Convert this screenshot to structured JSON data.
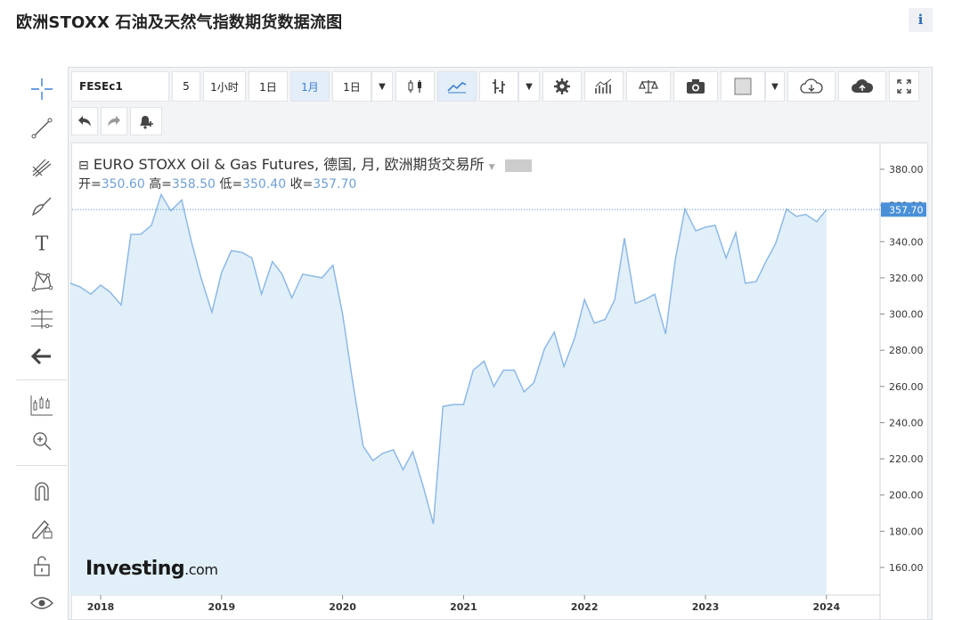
{
  "page": {
    "title": "欧洲STOXX 石油及天然气指数期货数据流图",
    "info_icon": "i"
  },
  "toolbar": {
    "symbol": "FESEc1",
    "intervals": [
      "5",
      "1小时",
      "1日",
      "1月",
      "1日"
    ],
    "active_interval": "1月",
    "icons": [
      "candlestick-icon",
      "area-chart-icon",
      "compare-icon",
      "settings-gear-icon",
      "indicators-icon",
      "balance-icon",
      "camera-icon",
      "color-swatch-icon",
      "cloud-download-icon",
      "cloud-upload-icon",
      "fullscreen-icon"
    ]
  },
  "toolbar2": {
    "icons": [
      "undo-icon",
      "redo-icon",
      "alert-bell-icon"
    ]
  },
  "left_tools": [
    "crosshair-icon",
    "trendline-icon",
    "fib-icon",
    "brush-icon",
    "text-icon",
    "pattern-icon",
    "measure-icon",
    "arrow-left-icon",
    "chart-type-icon",
    "zoom-icon",
    "magnet-icon",
    "pencil-lock-icon",
    "lock-icon",
    "eye-icon"
  ],
  "legend": {
    "title": "EURO STOXX Oil & Gas Futures, 德国, 月, 欧洲期货交易所",
    "open_label": "开=",
    "open": "350.60",
    "high_label": "高=",
    "high": "358.50",
    "low_label": "低=",
    "low": "350.40",
    "close_label": "收=",
    "close": "357.70"
  },
  "watermark": {
    "brand": "Investing",
    "suffix": ".com"
  },
  "colors": {
    "line": "#8db9e6",
    "fill": "#e1eff9",
    "accent": "#3b7fd0",
    "last_price_bg": "#4a90d9"
  },
  "chart_data": {
    "type": "area",
    "x_ticks": [
      "2018",
      "2019",
      "2020",
      "2021",
      "2022",
      "2023",
      "2024"
    ],
    "y_ticks": [
      "160.00",
      "180.00",
      "200.00",
      "220.00",
      "240.00",
      "260.00",
      "280.00",
      "300.00",
      "320.00",
      "340.00",
      "360.00",
      "380.00"
    ],
    "ylim": [
      150,
      390
    ],
    "x_range": [
      2017.75,
      2024.25
    ],
    "last_price": "357.70",
    "series": [
      {
        "values": [
          [
            2017.75,
            317
          ],
          [
            2017.83,
            315
          ],
          [
            2017.92,
            311
          ],
          [
            2018.0,
            316
          ],
          [
            2018.08,
            312
          ],
          [
            2018.17,
            305
          ],
          [
            2018.25,
            344
          ],
          [
            2018.33,
            344
          ],
          [
            2018.42,
            349
          ],
          [
            2018.5,
            366
          ],
          [
            2018.58,
            357
          ],
          [
            2018.67,
            363
          ],
          [
            2018.75,
            340
          ],
          [
            2018.83,
            320
          ],
          [
            2018.92,
            301
          ],
          [
            2019.0,
            323
          ],
          [
            2019.08,
            335
          ],
          [
            2019.17,
            334
          ],
          [
            2019.25,
            331
          ],
          [
            2019.33,
            311
          ],
          [
            2019.42,
            329
          ],
          [
            2019.5,
            322
          ],
          [
            2019.58,
            309
          ],
          [
            2019.67,
            322
          ],
          [
            2019.75,
            321
          ],
          [
            2019.83,
            320
          ],
          [
            2019.92,
            327
          ],
          [
            2020.0,
            300
          ],
          [
            2020.08,
            264
          ],
          [
            2020.17,
            227
          ],
          [
            2020.25,
            219
          ],
          [
            2020.33,
            223
          ],
          [
            2020.42,
            225
          ],
          [
            2020.5,
            214
          ],
          [
            2020.58,
            224
          ],
          [
            2020.67,
            204
          ],
          [
            2020.75,
            184
          ],
          [
            2020.83,
            249
          ],
          [
            2020.92,
            250
          ],
          [
            2021.0,
            250
          ],
          [
            2021.08,
            269
          ],
          [
            2021.17,
            274
          ],
          [
            2021.25,
            260
          ],
          [
            2021.33,
            269
          ],
          [
            2021.42,
            269
          ],
          [
            2021.5,
            257
          ],
          [
            2021.58,
            262
          ],
          [
            2021.67,
            281
          ],
          [
            2021.75,
            290
          ],
          [
            2021.83,
            271
          ],
          [
            2021.92,
            287
          ],
          [
            2022.0,
            308
          ],
          [
            2022.08,
            295
          ],
          [
            2022.17,
            297
          ],
          [
            2022.25,
            308
          ],
          [
            2022.33,
            342
          ],
          [
            2022.42,
            306
          ],
          [
            2022.5,
            308
          ],
          [
            2022.58,
            311
          ],
          [
            2022.67,
            289
          ],
          [
            2022.75,
            330
          ],
          [
            2022.83,
            358
          ],
          [
            2022.92,
            346
          ],
          [
            2023.0,
            348
          ],
          [
            2023.08,
            349
          ],
          [
            2023.17,
            331
          ],
          [
            2023.25,
            345
          ],
          [
            2023.33,
            317
          ],
          [
            2023.42,
            318
          ],
          [
            2023.5,
            329
          ],
          [
            2023.58,
            339
          ],
          [
            2023.67,
            358
          ],
          [
            2023.75,
            354
          ],
          [
            2023.83,
            355
          ],
          [
            2023.92,
            351
          ],
          [
            2024.0,
            357.7
          ]
        ]
      }
    ]
  }
}
